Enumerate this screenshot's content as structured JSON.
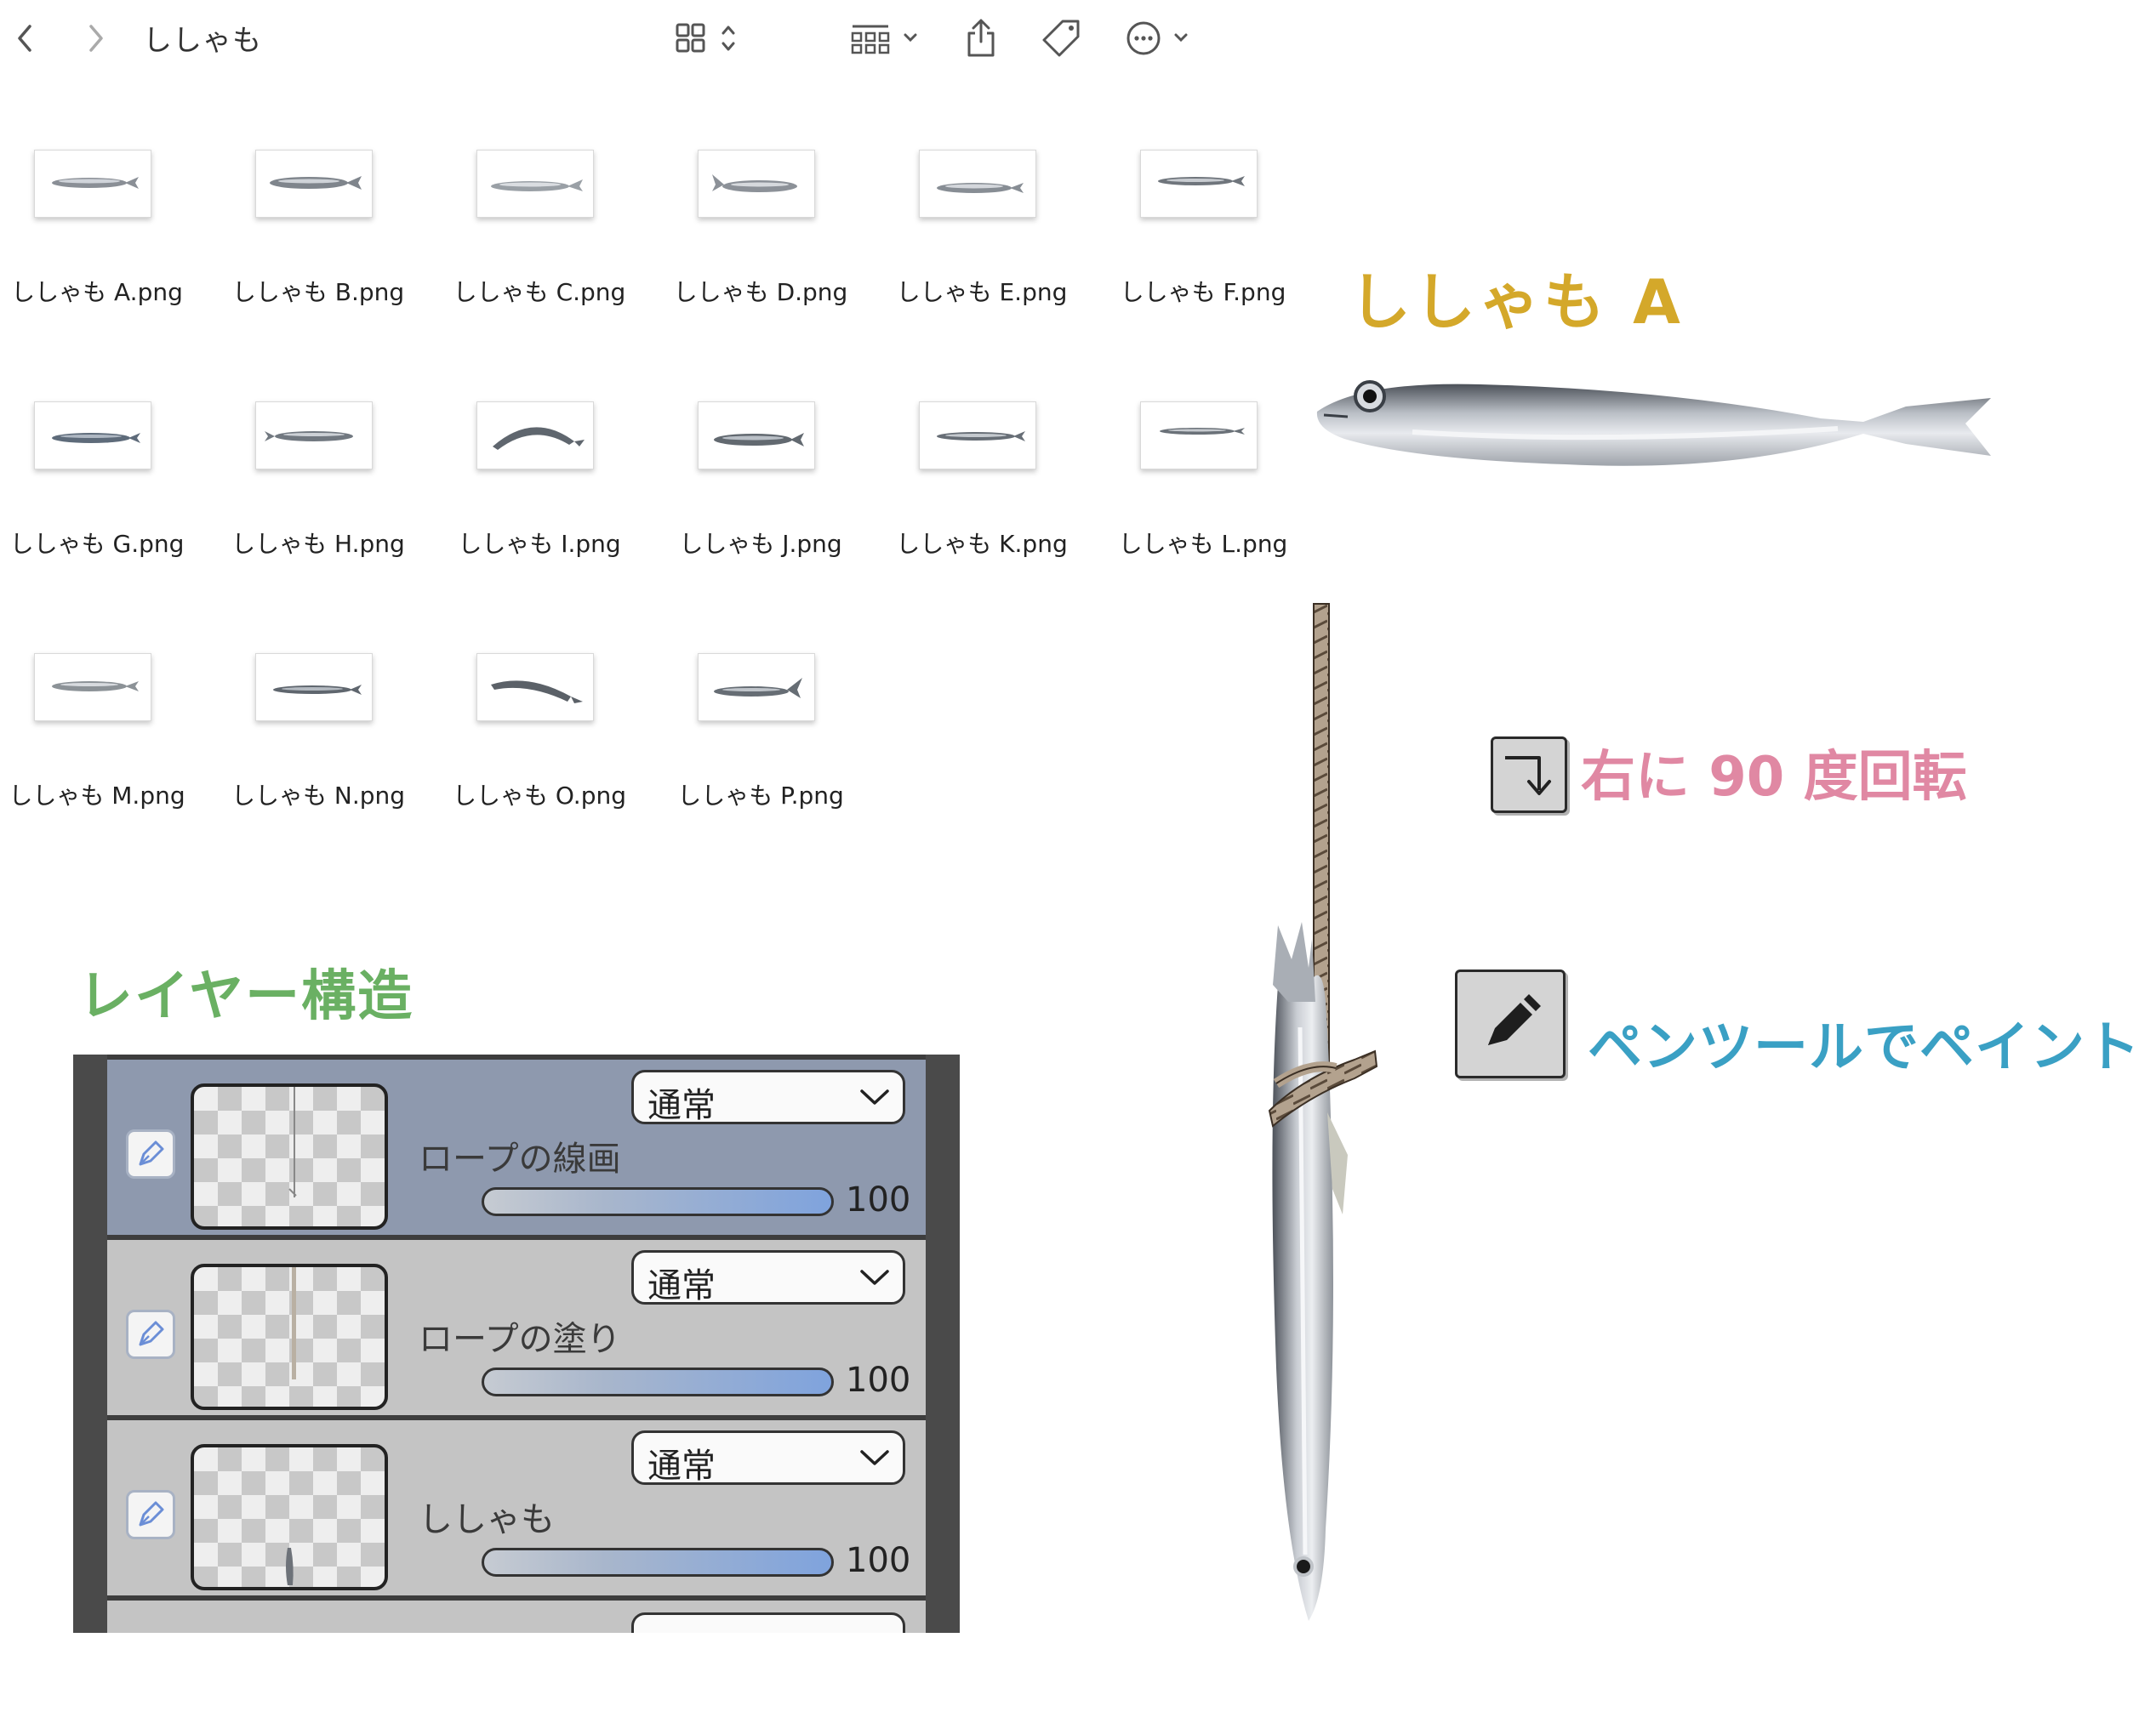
{
  "toolbar": {
    "folder_title": "ししゃも",
    "icons": [
      "back-chevron-icon",
      "forward-chevron-icon",
      "grid-view-icon",
      "updown-chevron-icon",
      "group-icon",
      "share-icon",
      "tag-icon",
      "more-icon"
    ]
  },
  "files": [
    {
      "name": "ししゃも A.png"
    },
    {
      "name": "ししゃも B.png"
    },
    {
      "name": "ししゃも C.png"
    },
    {
      "name": "ししゃも D.png"
    },
    {
      "name": "ししゃも E.png"
    },
    {
      "name": "ししゃも F.png"
    },
    {
      "name": "ししゃも G.png"
    },
    {
      "name": "ししゃも H.png"
    },
    {
      "name": "ししゃも I.png"
    },
    {
      "name": "ししゃも J.png"
    },
    {
      "name": "ししゃも K.png"
    },
    {
      "name": "ししゃも L.png"
    },
    {
      "name": "ししゃも M.png"
    },
    {
      "name": "ししゃも N.png"
    },
    {
      "name": "ししゃも O.png"
    },
    {
      "name": "ししゃも P.png"
    }
  ],
  "headings": {
    "fish_a": "ししゃも A",
    "layer_structure": "レイヤー構造",
    "rotate": "右に 90 度回転",
    "pen_tool": "ペンツールでペイント"
  },
  "layers": [
    {
      "name": "ロープの線画",
      "blend": "通常",
      "opacity": "100",
      "selected": true
    },
    {
      "name": "ロープの塗り",
      "blend": "通常",
      "opacity": "100",
      "selected": false
    },
    {
      "name": "ししゃも",
      "blend": "通常",
      "opacity": "100",
      "selected": false
    }
  ],
  "colors": {
    "fish_heading": "#d4a82a",
    "layer_heading": "#6ab063",
    "rotate_heading": "#e088a3",
    "pen_heading": "#3aa0c4",
    "selected_layer": "#8e99ae"
  }
}
